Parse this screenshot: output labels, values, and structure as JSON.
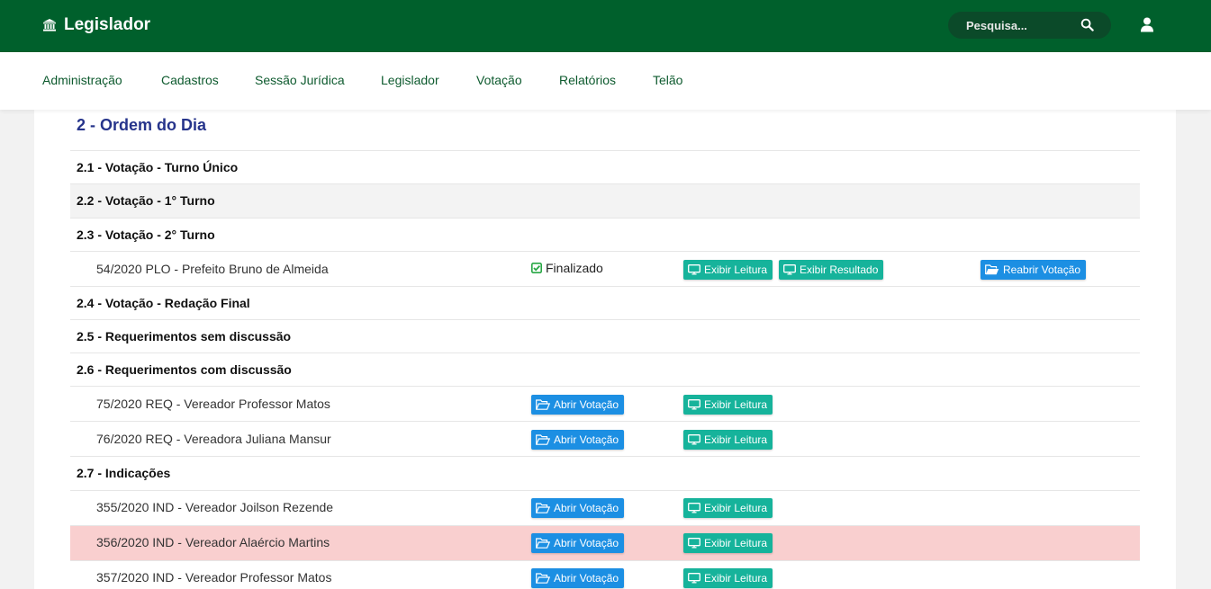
{
  "header": {
    "brand": "Legislador",
    "search_placeholder": "Pesquisa..."
  },
  "nav": [
    "Administração",
    "Cadastros",
    "Sessão Jurídica",
    "Legislador",
    "Votação",
    "Relatórios",
    "Telão"
  ],
  "section": {
    "title": "2 - Ordem do Dia",
    "subsections": {
      "s1": "2.1 - Votação - Turno Único",
      "s2": "2.2 - Votação - 1° Turno",
      "s3": "2.3 - Votação - 2° Turno",
      "s4": "2.4 - Votação - Redação Final",
      "s5": "2.5 - Requerimentos sem discussão",
      "s6": "2.6 - Requerimentos com discussão",
      "s7": "2.7 - Indicações"
    },
    "items": {
      "plo54": {
        "text": "54/2020 PLO - Prefeito Bruno de Almeida",
        "status": "Finalizado"
      },
      "req75": {
        "text": "75/2020 REQ - Vereador Professor Matos"
      },
      "req76": {
        "text": "76/2020 REQ - Vereadora Juliana Mansur"
      },
      "ind355": {
        "text": "355/2020 IND - Vereador Joilson Rezende"
      },
      "ind356": {
        "text": "356/2020 IND - Vereador Alaércio Martins"
      },
      "ind357": {
        "text": "357/2020 IND - Vereador Professor Matos"
      }
    }
  },
  "buttons": {
    "abrir_votacao": "Abrir Votação",
    "exibir_leitura": "Exibir Leitura",
    "exibir_resultado": "Exibir Resultado",
    "reabrir_votacao": "Reabrir Votação"
  },
  "colors": {
    "header_green": "#00602c",
    "title_blue": "#26348b",
    "button_blue": "#1c8fe3",
    "button_teal": "#16b39b",
    "highlight_row": "#f9cfcf",
    "status_check": "#28a745"
  },
  "icons": {
    "brand": "landmark-icon",
    "search": "search-icon",
    "user": "user-icon",
    "status": "check-square-icon",
    "abrir": "folder-open-icon",
    "exibir": "monitor-icon"
  }
}
